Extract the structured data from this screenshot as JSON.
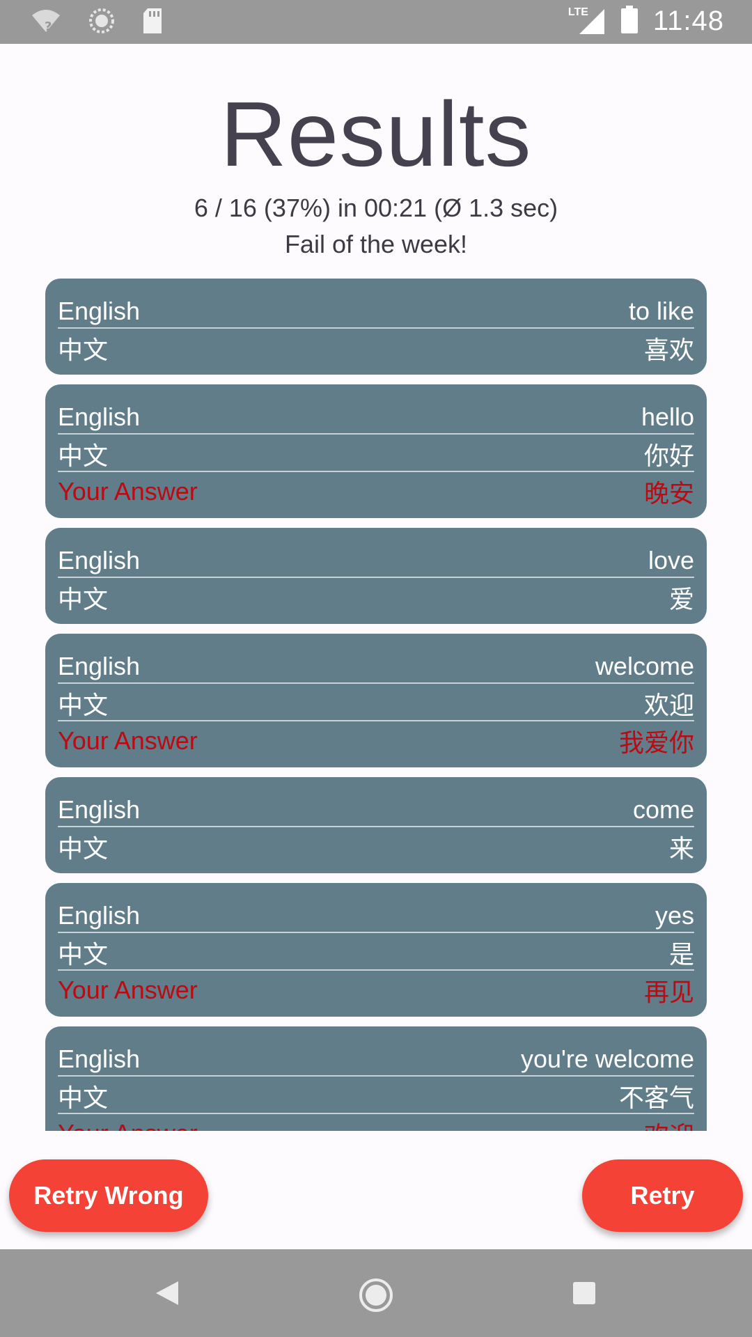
{
  "status_bar": {
    "time": "11:48",
    "network": "LTE",
    "icons": [
      "wifi-unknown-icon",
      "sync-icon",
      "sd-card-icon",
      "signal-icon",
      "battery-icon"
    ]
  },
  "title": "Results",
  "stats": "6 / 16 (37%) in 00:21 (Ø 1.3 sec)",
  "subtitle": "Fail of the week!",
  "labels": {
    "english": "English",
    "chinese": "中文",
    "answer": "Your Answer"
  },
  "cards": [
    {
      "english": "to like",
      "chinese": "喜欢",
      "answer": null
    },
    {
      "english": "hello",
      "chinese": "你好",
      "answer": "晚安"
    },
    {
      "english": "love",
      "chinese": "爱",
      "answer": null
    },
    {
      "english": "welcome",
      "chinese": "欢迎",
      "answer": "我爱你"
    },
    {
      "english": "come",
      "chinese": "来",
      "answer": null
    },
    {
      "english": "yes",
      "chinese": "是",
      "answer": "再见"
    },
    {
      "english": "you're welcome",
      "chinese": "不客气",
      "answer": "欢迎"
    }
  ],
  "buttons": {
    "retry_wrong": "Retry Wrong",
    "retry": "Retry"
  },
  "colors": {
    "card": "#617d89",
    "button": "#f44336",
    "wrong_answer": "#bb0a12",
    "bars": "#999999",
    "background": "#fdfbfe"
  }
}
